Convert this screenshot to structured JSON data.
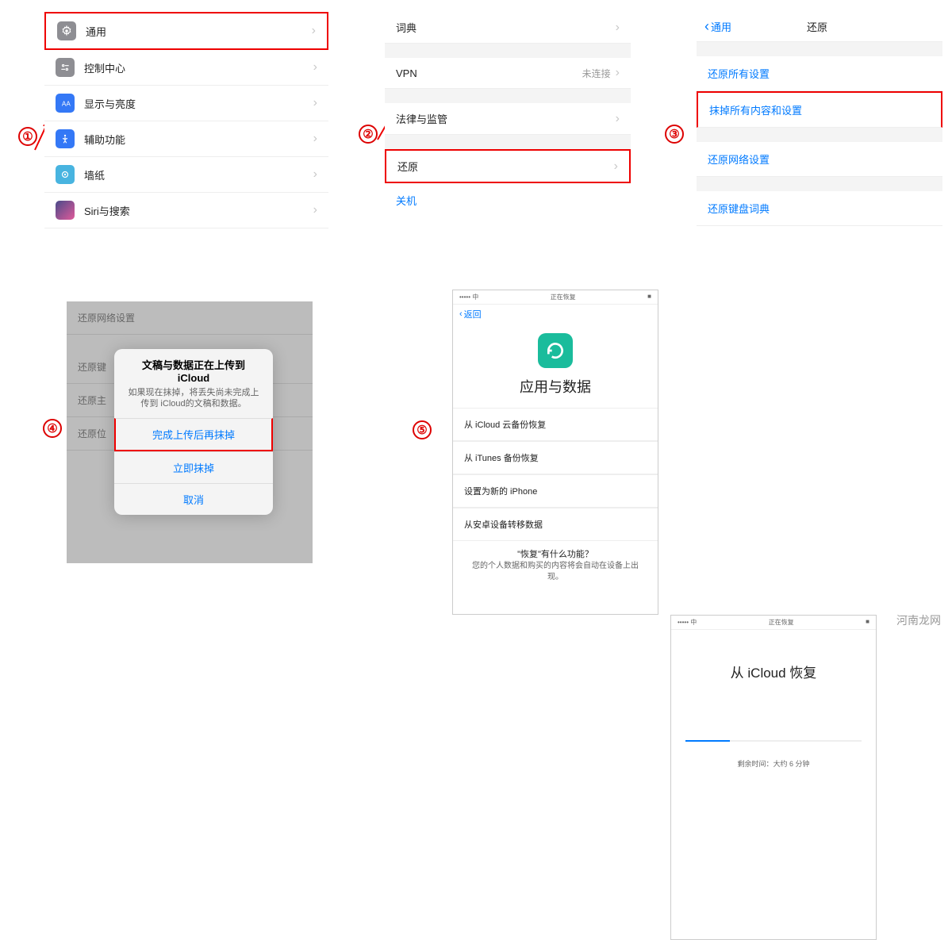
{
  "steps": [
    "①",
    "②",
    "③",
    "④",
    "⑤"
  ],
  "panel1": {
    "items": [
      {
        "label": "通用",
        "icon_bg": "#888",
        "icon": "gear"
      },
      {
        "label": "控制中心",
        "icon_bg": "#888",
        "icon": "switches"
      },
      {
        "label": "显示与亮度",
        "icon_bg": "#3478f6",
        "icon": "brightness"
      },
      {
        "label": "辅助功能",
        "icon_bg": "#3478f6",
        "icon": "accessibility"
      },
      {
        "label": "墙纸",
        "icon_bg": "#48b4e0",
        "icon": "wallpaper"
      },
      {
        "label": "Siri与搜索",
        "icon_bg": "#222",
        "icon": "siri"
      }
    ]
  },
  "panel2": {
    "items": [
      {
        "label": "词典"
      },
      {
        "label": "VPN",
        "value": "未连接"
      },
      {
        "label": "法律与监管"
      },
      {
        "label": "还原",
        "highlight": true
      },
      {
        "label": "关机",
        "link": true
      }
    ]
  },
  "panel3": {
    "back": "通用",
    "title": "还原",
    "items": [
      {
        "label": "还原所有设置"
      },
      {
        "label": "抹掉所有内容和设置",
        "highlight": true
      },
      {
        "label": "还原网络设置",
        "gap": true
      },
      {
        "label": "还原键盘词典",
        "gap": true
      }
    ]
  },
  "panel4": {
    "bg_rows": [
      "还原网络设置",
      "还原键",
      "还原主",
      "还原位"
    ],
    "dialog": {
      "title": "文稿与数据正在上传到 iCloud",
      "body": "如果现在抹掉，将丢失尚未完成上传到 iCloud的文稿和数据。",
      "btn1": "完成上传后再抹掉",
      "btn2": "立即抹掉",
      "btn3": "取消"
    }
  },
  "panel5a": {
    "carrier": "••••• 中",
    "status": "正在恢复",
    "back": "返回",
    "title": "应用与数据",
    "options": [
      "从 iCloud 云备份恢复",
      "从 iTunes 备份恢复",
      "设置为新的 iPhone",
      "从安卓设备转移数据"
    ],
    "footer_q": "\"恢复\"有什么功能？",
    "footer": "您的个人数据和购买的内容将会自动在设备上出现。"
  },
  "panel5b": {
    "carrier": "••••• 中",
    "status": "正在恢复",
    "title": "从 iCloud 恢复",
    "remaining": "剩余时间：大约 6 分钟"
  },
  "watermark": "河南龙网"
}
